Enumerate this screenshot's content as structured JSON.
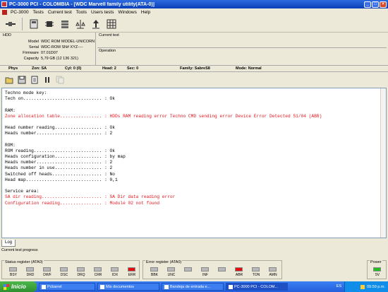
{
  "window": {
    "title": "PC-3000 PCI - COLOMBIA - [WDC Marvell family utility(ATA-0)]"
  },
  "menu": [
    "PC-3000",
    "Tests",
    "Current test",
    "Tools",
    "Users tests",
    "Windows",
    "Help"
  ],
  "hdd": {
    "label": "HDD",
    "fields": [
      {
        "k": "Model",
        "v": "WDC ROM MODEL-UNICORN"
      },
      {
        "k": "Serial",
        "v": "WDC-ROM SN# XYZ----"
      },
      {
        "k": "Firmware",
        "v": "07.01D07"
      },
      {
        "k": "Capacity",
        "v": "5,79 GB (12 136 321)"
      }
    ]
  },
  "current_test_label": "Current test",
  "operation_label": "Operation",
  "status": {
    "phys": "Phys",
    "zone": "Zon: SA",
    "cyl": "Cyl: 0 (0)",
    "head": "Head: 2",
    "sec": "Sec: 0",
    "family": "Family: SabreS8",
    "mode": "Mode: Normal"
  },
  "log_lines": [
    {
      "t": "Techno mode key:",
      "e": false
    },
    {
      "t": "Tech on.............................. : Ok",
      "e": false
    },
    {
      "t": "",
      "e": false
    },
    {
      "t": "RAM:",
      "e": false
    },
    {
      "t": "Zone allocation table................ : HDDs RAM reading error Techno CMD sending error Device Error Detected 51/04 (ABR)",
      "e": true
    },
    {
      "t": "",
      "e": false
    },
    {
      "t": "Head number reading.................. : Ok",
      "e": false
    },
    {
      "t": "Heads number......................... : 2",
      "e": false
    },
    {
      "t": "",
      "e": false
    },
    {
      "t": "ROM:",
      "e": false
    },
    {
      "t": "ROM reading.......................... : Ok",
      "e": false
    },
    {
      "t": "Heads configuration.................. : by map",
      "e": false
    },
    {
      "t": "Heads number......................... : 2",
      "e": false
    },
    {
      "t": "Heads number in use.................. : 2",
      "e": false
    },
    {
      "t": "Switched off heads................... : No",
      "e": false
    },
    {
      "t": "Head map............................. : 0,1",
      "e": false
    },
    {
      "t": "",
      "e": false
    },
    {
      "t": "Service area:",
      "e": false
    },
    {
      "t": "SA dir reading....................... : SA Dir data reading error",
      "e": true
    },
    {
      "t": "Configuration reading................ : Module 02 not found",
      "e": true
    }
  ],
  "tab_log": "Log",
  "progress_label": "Current test progress",
  "status_register": {
    "title": "Status register (ATA0)",
    "leds": [
      {
        "label": "BSY",
        "on": false
      },
      {
        "label": "DRD",
        "on": false
      },
      {
        "label": "DWF",
        "on": false
      },
      {
        "label": "DSC",
        "on": false
      },
      {
        "label": "DRQ",
        "on": false
      },
      {
        "label": "CRR",
        "on": false
      },
      {
        "label": "IDX",
        "on": false
      },
      {
        "label": "ERR",
        "on": true
      }
    ]
  },
  "error_register": {
    "title": "Error register (ATA0)",
    "leds": [
      {
        "label": "BBK",
        "on": false
      },
      {
        "label": "UNC",
        "on": false
      },
      {
        "label": "",
        "on": false
      },
      {
        "label": "INF",
        "on": false
      },
      {
        "label": "",
        "on": false
      },
      {
        "label": "ABR",
        "on": true
      },
      {
        "label": "TON",
        "on": false
      },
      {
        "label": "AMN",
        "on": false
      }
    ]
  },
  "power": {
    "title": "Power",
    "label": "5V",
    "on": true
  },
  "taskbar": {
    "start": "Inicio",
    "tasks": [
      "Pcbarrel",
      "Mis documentos",
      "Bandeja de entrada e...",
      "PC-3000 PCI - COLOM..."
    ],
    "lang": "ES",
    "clock": "09:59 p.m."
  },
  "colors": {
    "error_text": "#e8141b",
    "title_bar": "#0a3fb8",
    "led_on": "#e01010"
  }
}
